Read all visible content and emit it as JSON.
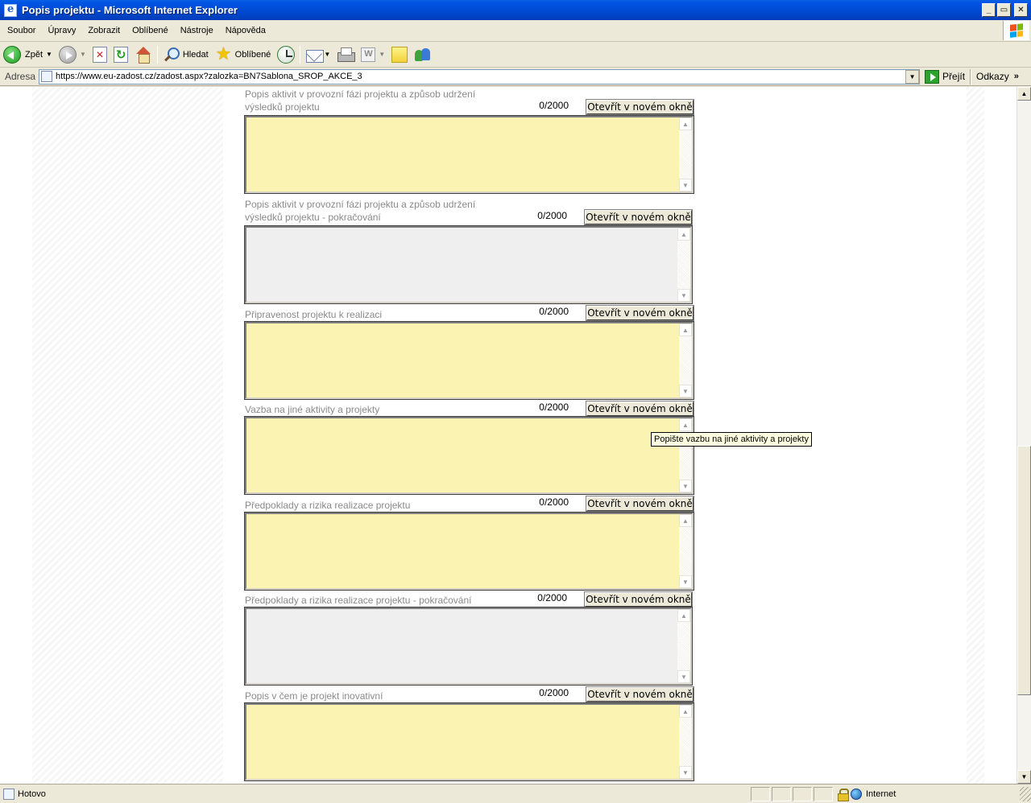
{
  "window": {
    "title": "Popis projektu - Microsoft Internet Explorer",
    "minimize": "_",
    "maximize": "▭",
    "close": "✕"
  },
  "menu": [
    "Soubor",
    "Úpravy",
    "Zobrazit",
    "Oblíbené",
    "Nástroje",
    "Nápověda"
  ],
  "toolbar": {
    "back_label": "Zpět",
    "search_label": "Hledat",
    "favorites_label": "Oblíbené"
  },
  "address": {
    "label": "Adresa",
    "url": "https://www.eu-zadost.cz/zadost.aspx?zalozka=BN7Sablona_SROP_AKCE_3",
    "go_label": "Přejít",
    "links_label": "Odkazy"
  },
  "fields": [
    {
      "label": "Popis aktivit v provozní fázi projektu a způsob udržení výsledků projektu",
      "counter": "0/2000",
      "button": "Otevřít v novém okně",
      "color": "yellow",
      "value": ""
    },
    {
      "label": "Popis aktivit v provozní fázi projektu a způsob udržení výsledků projektu - pokračování",
      "counter": "0/2000",
      "button": "Otevřít v novém okně",
      "color": "gray",
      "value": ""
    },
    {
      "label": "Připravenost projektu k realizaci",
      "counter": "0/2000",
      "button": "Otevřít v novém okně",
      "color": "yellow",
      "value": ""
    },
    {
      "label": "Vazba na jiné aktivity a projekty",
      "counter": "0/2000",
      "button": "Otevřít v novém okně",
      "color": "yellow",
      "value": ""
    },
    {
      "label": "Předpoklady a rizika realizace projektu",
      "counter": "0/2000",
      "button": "Otevřít v novém okně",
      "color": "yellow",
      "value": ""
    },
    {
      "label": "Předpoklady a rizika realizace projektu - pokračování",
      "counter": "0/2000",
      "button": "Otevřít v novém okně",
      "color": "gray",
      "value": ""
    },
    {
      "label": "Popis v čem je projekt inovativní",
      "counter": "0/2000",
      "button": "Otevřít v novém okně",
      "color": "yellow",
      "value": ""
    }
  ],
  "tooltip": "Popište vazbu na jiné aktivity a projekty",
  "status": {
    "text": "Hotovo",
    "zone": "Internet"
  },
  "colors": {
    "field_yellow": "#FBF3B2",
    "field_gray": "#EFEFEF",
    "titlebar_blue": "#0054E3"
  }
}
